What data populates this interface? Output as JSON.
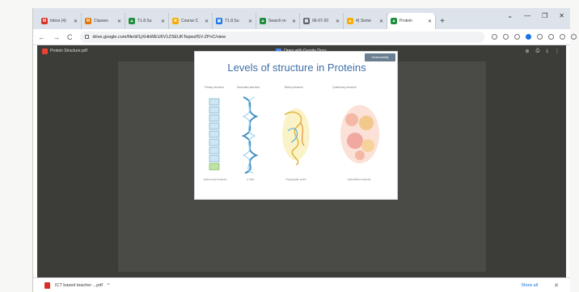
{
  "browser": {
    "tabs": [
      {
        "title": "Inbox (4)",
        "fav": "M",
        "color": "#d93025"
      },
      {
        "title": "Classes",
        "fav": "M",
        "color": "#e37400"
      },
      {
        "title": "T1.8.Su",
        "fav": "▲",
        "color": "#1e8e3e"
      },
      {
        "title": "Course C",
        "fav": "★",
        "color": "#f9ab00"
      },
      {
        "title": "T1.8.Su",
        "fav": "▤",
        "color": "#1a73e8"
      },
      {
        "title": "Search re",
        "fav": "▲",
        "color": "#1e8e3e"
      },
      {
        "title": "06-07-20",
        "fav": "▤",
        "color": "#5f6368"
      },
      {
        "title": "4) Some",
        "fav": "▲",
        "color": "#f9ab00"
      },
      {
        "title": "Protein",
        "fav": "▲",
        "color": "#1e8e3e",
        "active": true
      }
    ],
    "new_tab": "+",
    "window_controls": {
      "min": "—",
      "restore": "❐",
      "close": "✕",
      "menu": "⌄"
    },
    "nav": {
      "back": "←",
      "forward": "→",
      "reload": "C"
    },
    "url": "drive.google.com/file/d/1jXHkWEU6V1ZSEUKTepwzfSV-ZPvC/view"
  },
  "viewer": {
    "file_name": "Protein Structure.pdf",
    "open_with": "Open with Google Docs",
    "right_icons": [
      "⊕",
      "⎙",
      "⤓",
      "⋮"
    ]
  },
  "slide": {
    "title": "Levels of structure in Proteins",
    "logo": "Screencastify",
    "columns": [
      {
        "label": "Primary structure",
        "caption": "Amino acid residues"
      },
      {
        "label": "Secondary structure",
        "caption": "α helix"
      },
      {
        "label": "Tertiary structure",
        "caption": "Polypeptide chain"
      },
      {
        "label": "Quaternary structure",
        "caption": "Assembled subunits"
      }
    ]
  },
  "download": {
    "file": "ICT based teacher ...pdf",
    "chevron": "^",
    "show_all": "Show all",
    "close": "✕"
  }
}
